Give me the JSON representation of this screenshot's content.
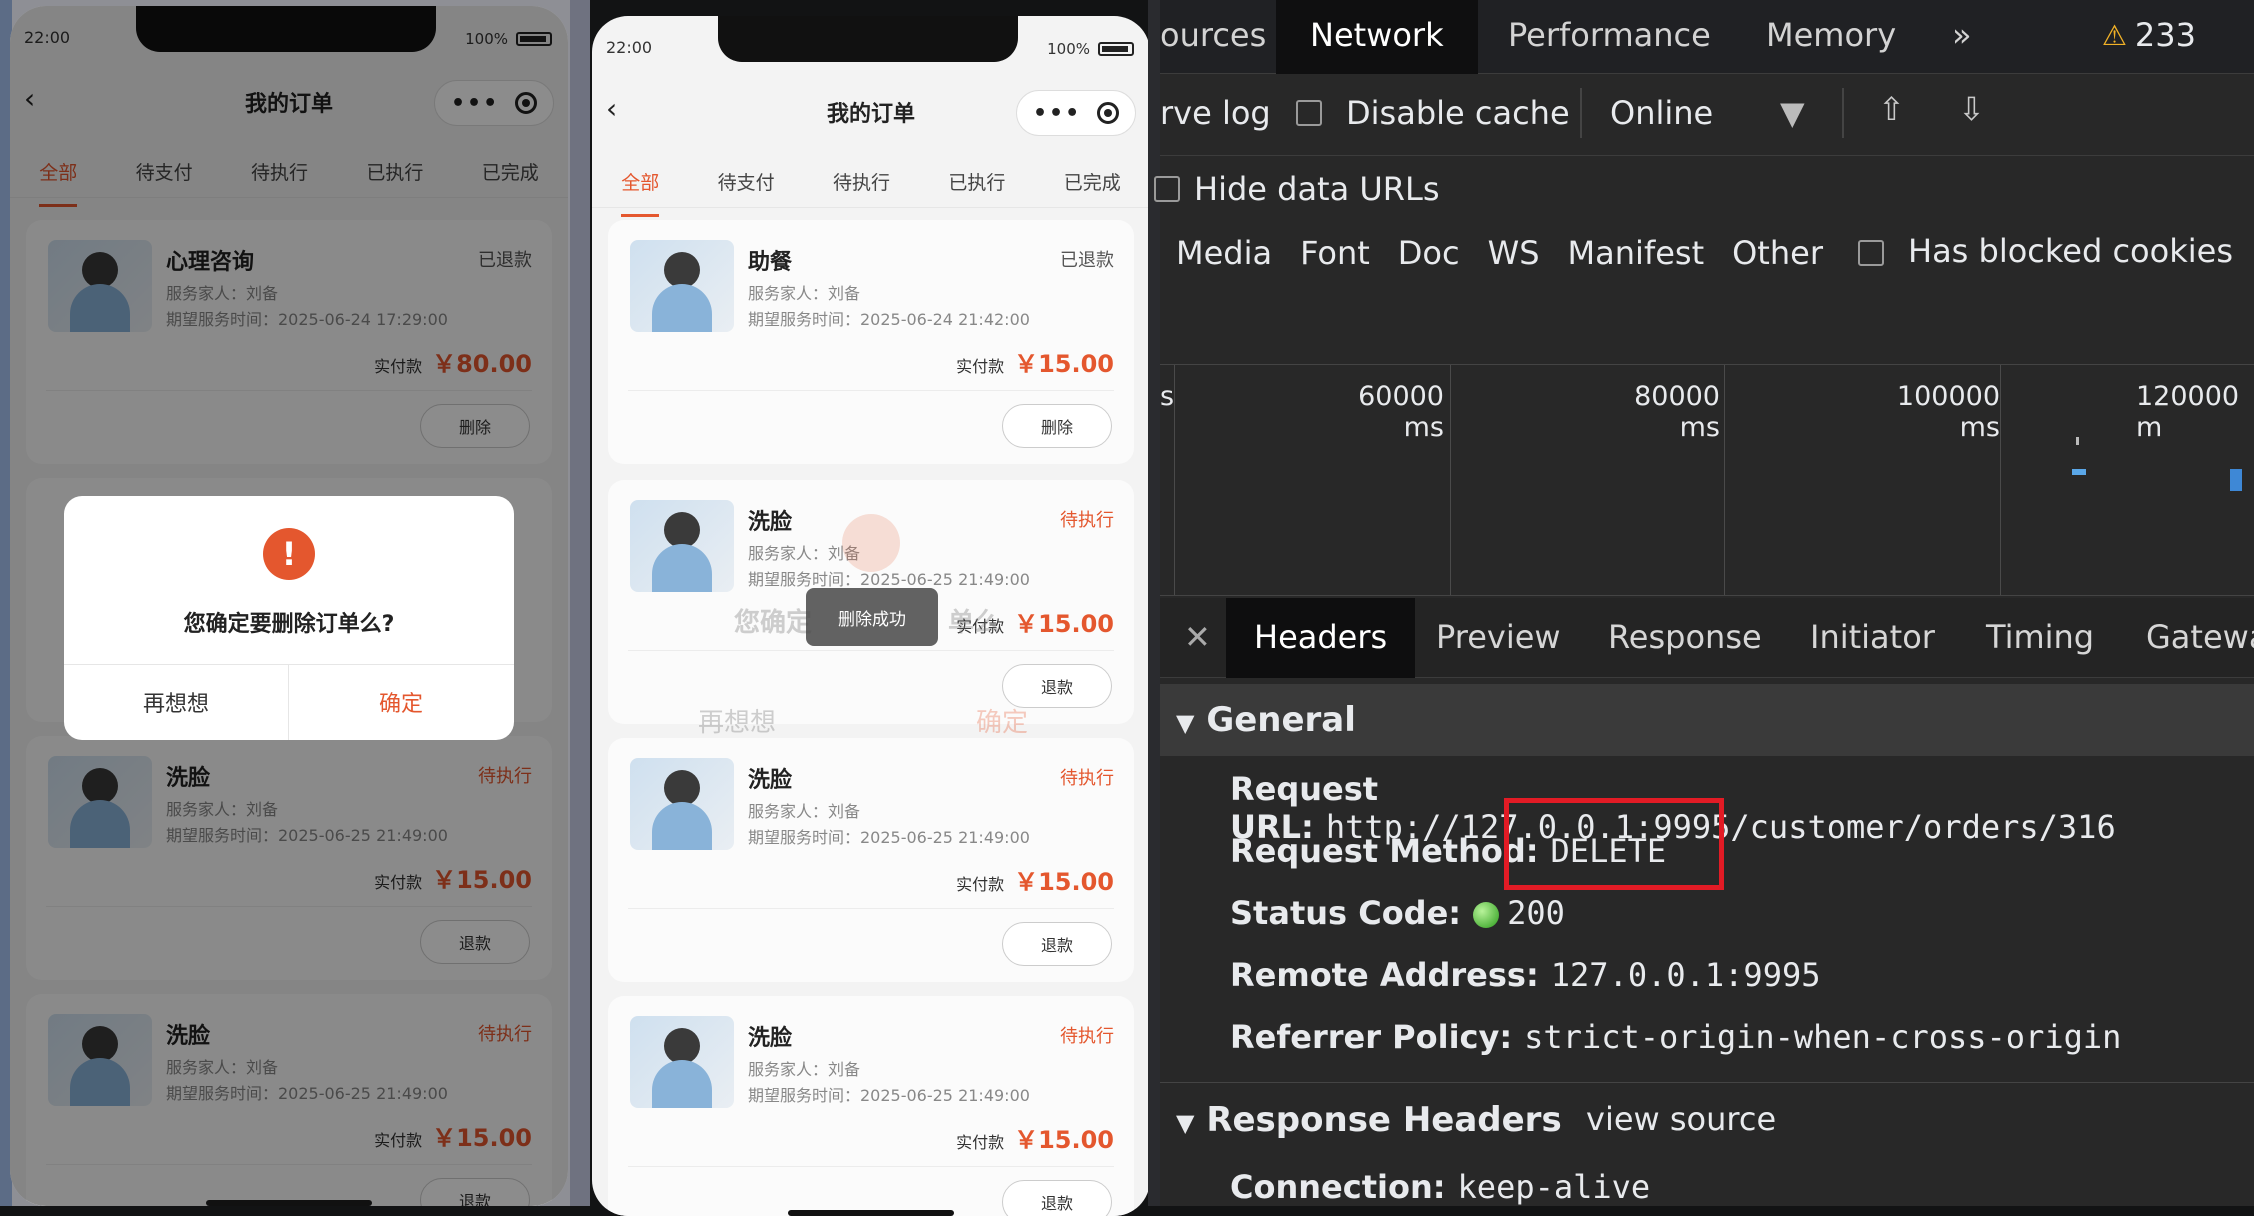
{
  "phone_left": {
    "status_time": "22:00",
    "battery_pct": "100%",
    "nav_title": "我的订单",
    "tabs": [
      "全部",
      "待支付",
      "待执行",
      "已执行",
      "已完成"
    ],
    "active_tab": "全部",
    "orders": [
      {
        "name": "心理咨询",
        "status": "已退款",
        "member": "服务家人：刘备",
        "time": "期望服务时间：2025-06-24 17:29:00",
        "pay_label": "实付款",
        "amount": "￥80.00",
        "button": "删除"
      },
      {
        "name": "洗脸",
        "status": "待执行",
        "member": "服务家人：刘备",
        "time": "期望服务时间：2025-06-25 21:49:00",
        "pay_label": "实付款",
        "amount": "￥15.00",
        "button": "退款"
      },
      {
        "name": "洗脸",
        "status": "待执行",
        "member": "服务家人：刘备",
        "time": "期望服务时间：2025-06-25 21:49:00",
        "pay_label": "实付款",
        "amount": "￥15.00",
        "button": "退款"
      }
    ],
    "modal": {
      "icon": "!",
      "message": "您确定要删除订单么?",
      "cancel": "再想想",
      "confirm": "确定"
    }
  },
  "phone_right": {
    "status_time": "22:00",
    "battery_pct": "100%",
    "nav_title": "我的订单",
    "tabs": [
      "全部",
      "待支付",
      "待执行",
      "已执行",
      "已完成"
    ],
    "active_tab": "全部",
    "orders": [
      {
        "name": "助餐",
        "status": "已退款",
        "member": "服务家人：刘备",
        "time": "期望服务时间：2025-06-24 21:42:00",
        "pay_label": "实付款",
        "amount": "￥15.00",
        "button": "删除"
      },
      {
        "name": "洗脸",
        "status": "待执行",
        "member": "服务家人：刘备",
        "time": "期望服务时间：2025-06-25 21:49:00",
        "pay_label": "实付款",
        "amount": "￥15.00",
        "button": "退款"
      },
      {
        "name": "洗脸",
        "status": "待执行",
        "member": "服务家人：刘备",
        "time": "期望服务时间：2025-06-25 21:49:00",
        "pay_label": "实付款",
        "amount": "￥15.00",
        "button": "退款"
      },
      {
        "name": "洗脸",
        "status": "待执行",
        "member": "服务家人：刘备",
        "time": "期望服务时间：2025-06-25 21:49:00",
        "pay_label": "实付款",
        "amount": "￥15.00",
        "button": "退款"
      }
    ],
    "toast": "删除成功",
    "ghost_text": "您确定",
    "ghost_text2": "单么",
    "ghost_cancel": "再想想",
    "ghost_confirm": "确定"
  },
  "devtools": {
    "tabs": [
      "ources",
      "Network",
      "Performance",
      "Memory"
    ],
    "more_tabs": "»",
    "warnings": "233",
    "preserve_log": "rve log",
    "disable_cache": "Disable cache",
    "throttle": "Online",
    "hide_data_urls": "Hide data URLs",
    "filters": [
      "Media",
      "Font",
      "Doc",
      "WS",
      "Manifest",
      "Other"
    ],
    "has_blocked_cookies": "Has blocked cookies",
    "timeline_labels": [
      "s",
      "60000 ms",
      "80000 ms",
      "100000 ms",
      "120000 m"
    ],
    "detail_tabs": [
      "Headers",
      "Preview",
      "Response",
      "Initiator",
      "Timing",
      "Gatewa"
    ],
    "general_title": "General",
    "request_url_label": "Request URL:",
    "request_url": "http://127.0.0.1:9995/customer/orders/316",
    "request_method_label": "Request Method:",
    "request_method": "DELETE",
    "status_code_label": "Status Code:",
    "status_code": "200",
    "remote_address_label": "Remote Address:",
    "remote_address": "127.0.0.1:9995",
    "referrer_policy_label": "Referrer Policy:",
    "referrer_policy": "strict-origin-when-cross-origin",
    "response_headers_title": "Response Headers",
    "view_source": "view source",
    "connection_label": "Connection:",
    "connection": "keep-alive"
  },
  "colors": {
    "accent": "#e4572e",
    "highlight_box": "#e21b25"
  }
}
